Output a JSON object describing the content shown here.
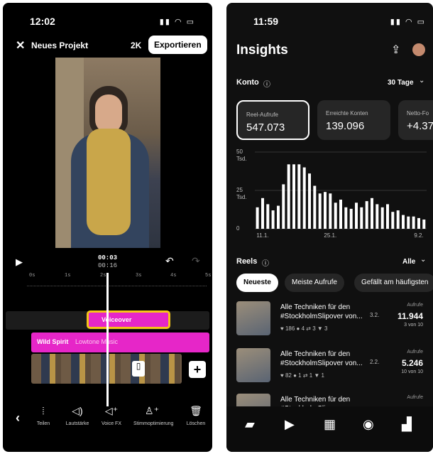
{
  "editor": {
    "status_time": "12:02",
    "project_title": "Neues Projekt",
    "resolution": "2K",
    "export_label": "Exportieren",
    "time_current": "00:03",
    "time_total": "00:16",
    "ruler_ticks": [
      "0s",
      "1s",
      "2s",
      "3s",
      "4s",
      "5s"
    ],
    "voiceover_label": "Voiceover",
    "music_title": "Wild Spirit",
    "music_artist": "Lowtone Music",
    "tools": [
      {
        "label": "Teilen",
        "icon": "split-icon"
      },
      {
        "label": "Lautstärke",
        "icon": "volume-icon"
      },
      {
        "label": "Voice FX",
        "icon": "voice-fx-icon"
      },
      {
        "label": "Stimmoptimierung",
        "icon": "voice-enhance-icon"
      },
      {
        "label": "Löschen",
        "icon": "trash-icon"
      }
    ],
    "accent": "#e626c8",
    "voiceover_border": "#f5c518"
  },
  "insights": {
    "status_time": "11:59",
    "title": "Insights",
    "konto_label": "Konto",
    "range_label": "30 Tage",
    "cards": [
      {
        "label": "Reel-Aufrufe",
        "value": "547.073"
      },
      {
        "label": "Erreichte Konten",
        "value": "139.096"
      },
      {
        "label": "Netto-Fo",
        "value": "+4.37"
      }
    ],
    "y_labels": [
      "50\nTsd.",
      "25\nTsd.",
      "0"
    ],
    "x_labels": [
      "11.1.",
      "25.1.",
      "9.2."
    ],
    "reels_label": "Reels",
    "filter_all": "Alle",
    "chips": [
      "Neueste",
      "Meiste Aufrufe",
      "Gefällt am häufigsten"
    ],
    "reels": [
      {
        "title": "Alle Techniken für den #StockholmSlipover von...",
        "date": "3.2.",
        "stats": "♥ 186  ● 4  ⇄ 3  ▼ 3",
        "aufrufe_label": "Aufrufe",
        "value": "11.944",
        "rank": "3 von 10"
      },
      {
        "title": "Alle Techniken für den #StockholmSlipover von...",
        "date": "2.2.",
        "stats": "♥ 82  ● 1  ⇄ 1  ▼ 1",
        "aufrufe_label": "Aufrufe",
        "value": "5.246",
        "rank": "10 von 10"
      },
      {
        "title": "Alle Techniken für den #StockholmSlipover von...",
        "date": "",
        "stats": "",
        "aufrufe_label": "Aufrufe",
        "value": "",
        "rank": ""
      }
    ]
  },
  "chart_data": {
    "type": "bar",
    "title": "",
    "xlabel": "",
    "ylabel": "",
    "ylim": [
      0,
      50000
    ],
    "x_ticks": [
      "11.1.",
      "25.1.",
      "9.2."
    ],
    "values": [
      14000,
      20000,
      16000,
      12000,
      15000,
      29000,
      42000,
      42000,
      42000,
      40000,
      36000,
      28000,
      23000,
      24000,
      23000,
      17000,
      19000,
      14000,
      13000,
      17000,
      14000,
      18000,
      20000,
      16000,
      14000,
      16000,
      11000,
      12000,
      9000,
      8000,
      8000,
      7000,
      6000
    ],
    "bar_color": "#ffffff"
  }
}
